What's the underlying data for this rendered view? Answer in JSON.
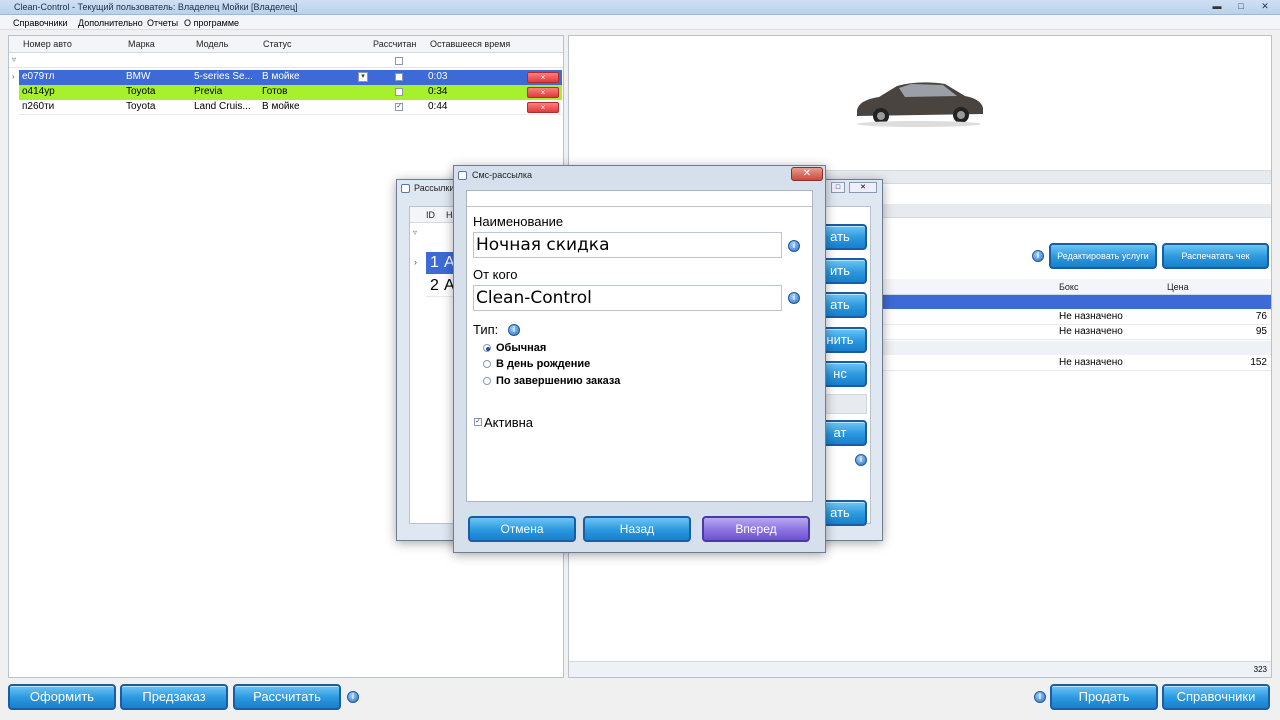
{
  "app": {
    "title": "Clean-Control - Текущий пользователь: Владелец Мойки [Владелец]"
  },
  "menu": [
    "Справочники",
    "Дополнительно",
    "Отчеты",
    "О программе"
  ],
  "orders": {
    "columns": [
      "Номер авто",
      "Марка",
      "Модель",
      "Статус",
      "Рассчитан",
      "Оставшееся время"
    ],
    "rows": [
      {
        "plate": "е079тл",
        "brand": "BMW",
        "model": "5-series Se...",
        "status": "В мойке",
        "calculated": false,
        "time": "0:03"
      },
      {
        "plate": "о414ур",
        "brand": "Toyota",
        "model": "Previa",
        "status": "Готов",
        "calculated": false,
        "time": "0:34"
      },
      {
        "plate": "п260ти",
        "brand": "Toyota",
        "model": "Land Cruis...",
        "status": "В мойке",
        "calculated": true,
        "time": "0:44"
      }
    ],
    "delete_label": "×"
  },
  "bottom_left": {
    "process": "Оформить",
    "preorder": "Предзаказ",
    "calculate": "Рассчитать"
  },
  "bottom_right": {
    "sell": "Продать",
    "catalogs": "Справочники"
  },
  "services": {
    "edit_button": "Редактировать услуги",
    "print_button": "Распечатать чек",
    "columns": [
      "Бокс",
      "Цена"
    ],
    "rows": [
      {
        "box": "Не назначено",
        "price": "76"
      },
      {
        "box": "Не назначено",
        "price": "95"
      },
      {
        "box": "Не назначено",
        "price": "152"
      }
    ],
    "total": "323"
  },
  "mailing_window": {
    "title": "Рассылки",
    "id_header": "ID",
    "name_header": "На",
    "rows": [
      {
        "id": "1",
        "name": "А"
      },
      {
        "id": "2",
        "name": "А"
      }
    ],
    "side_buttons": [
      "ать",
      "ить",
      "ать",
      "нить",
      "нс",
      "ат",
      "ать"
    ]
  },
  "sms_dialog": {
    "title": "Смс-рассылка",
    "name_label": "Наименование",
    "name_value": "Ночная скидка",
    "from_label": "От кого",
    "from_value": "Clean-Control",
    "type_label": "Тип:",
    "types": [
      {
        "label": "Обычная",
        "selected": true
      },
      {
        "label": "В день рождение",
        "selected": false
      },
      {
        "label": "По завершению заказа",
        "selected": false
      }
    ],
    "active_label": "Активна",
    "active": true,
    "cancel": "Отмена",
    "back": "Назад",
    "next": "Вперед"
  }
}
